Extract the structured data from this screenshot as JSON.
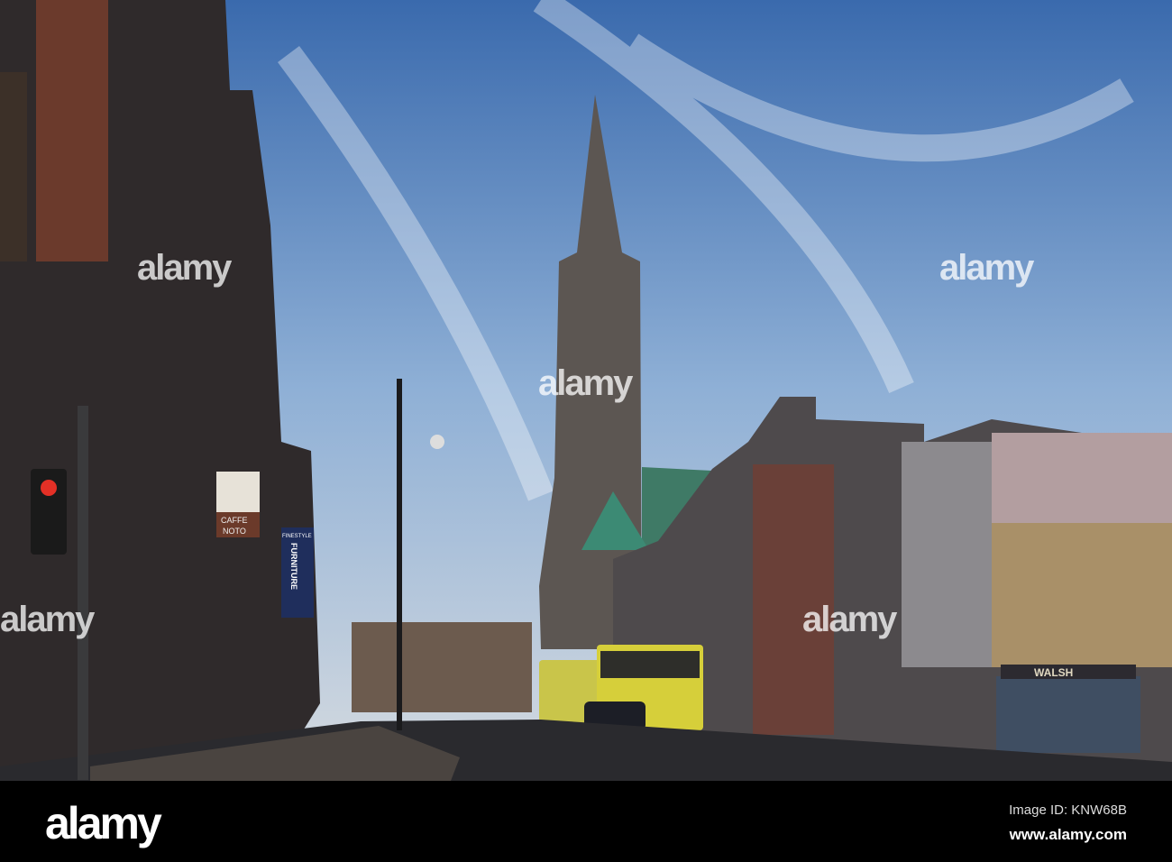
{
  "photo": {
    "signs": {
      "cafe_line1": "CAFFE",
      "cafe_line2": "NOTO",
      "furniture_top": "FINESTYLE",
      "furniture_vertical": "FURNITURE",
      "shop_walsh": "WALSH"
    }
  },
  "watermark": {
    "text": "alamy"
  },
  "footer": {
    "logo": "alamy",
    "image_id": "Image ID: KNW68B",
    "url": "www.alamy.com"
  },
  "colors": {
    "sky_top": "#3a6aad",
    "sky_bottom": "#c9d4e0",
    "bar": "#000000"
  }
}
